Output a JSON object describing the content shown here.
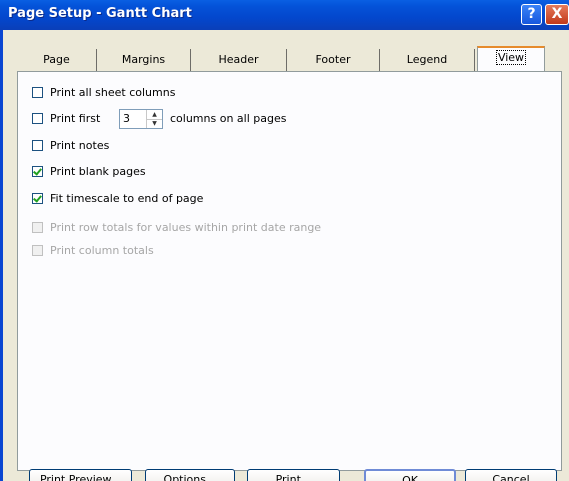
{
  "window": {
    "title": "Page Setup - Gantt Chart",
    "help_glyph": "?",
    "close_glyph": "X"
  },
  "tabs": [
    {
      "label": "Page"
    },
    {
      "label": "Margins"
    },
    {
      "label": "Header"
    },
    {
      "label": "Footer"
    },
    {
      "label": "Legend"
    },
    {
      "label": "View",
      "selected": true
    }
  ],
  "options": {
    "print_all_columns": {
      "label": "Print all sheet columns",
      "checked": false,
      "enabled": true
    },
    "print_first": {
      "label": "Print first",
      "value": "3",
      "suffix": "columns on all pages",
      "checked": false,
      "enabled": true
    },
    "print_notes": {
      "label": "Print notes",
      "checked": false,
      "enabled": true
    },
    "print_blank": {
      "label": "Print blank pages",
      "checked": true,
      "enabled": true
    },
    "fit_timescale": {
      "label": "Fit timescale to end of page",
      "checked": true,
      "enabled": true
    },
    "row_totals": {
      "label": "Print row totals for values within print date range",
      "checked": false,
      "enabled": false
    },
    "column_totals": {
      "label": "Print column totals",
      "checked": false,
      "enabled": false
    }
  },
  "buttons": {
    "print_preview": "Print Preview...",
    "options": "Options...",
    "print": "Print...",
    "ok": "OK",
    "cancel": "Cancel"
  },
  "colors": {
    "titlebar": "#0453d9",
    "dialog_bg": "#ece9d8",
    "panel_bg": "#fcfcfe",
    "tab_highlight": "#e68b2c"
  }
}
